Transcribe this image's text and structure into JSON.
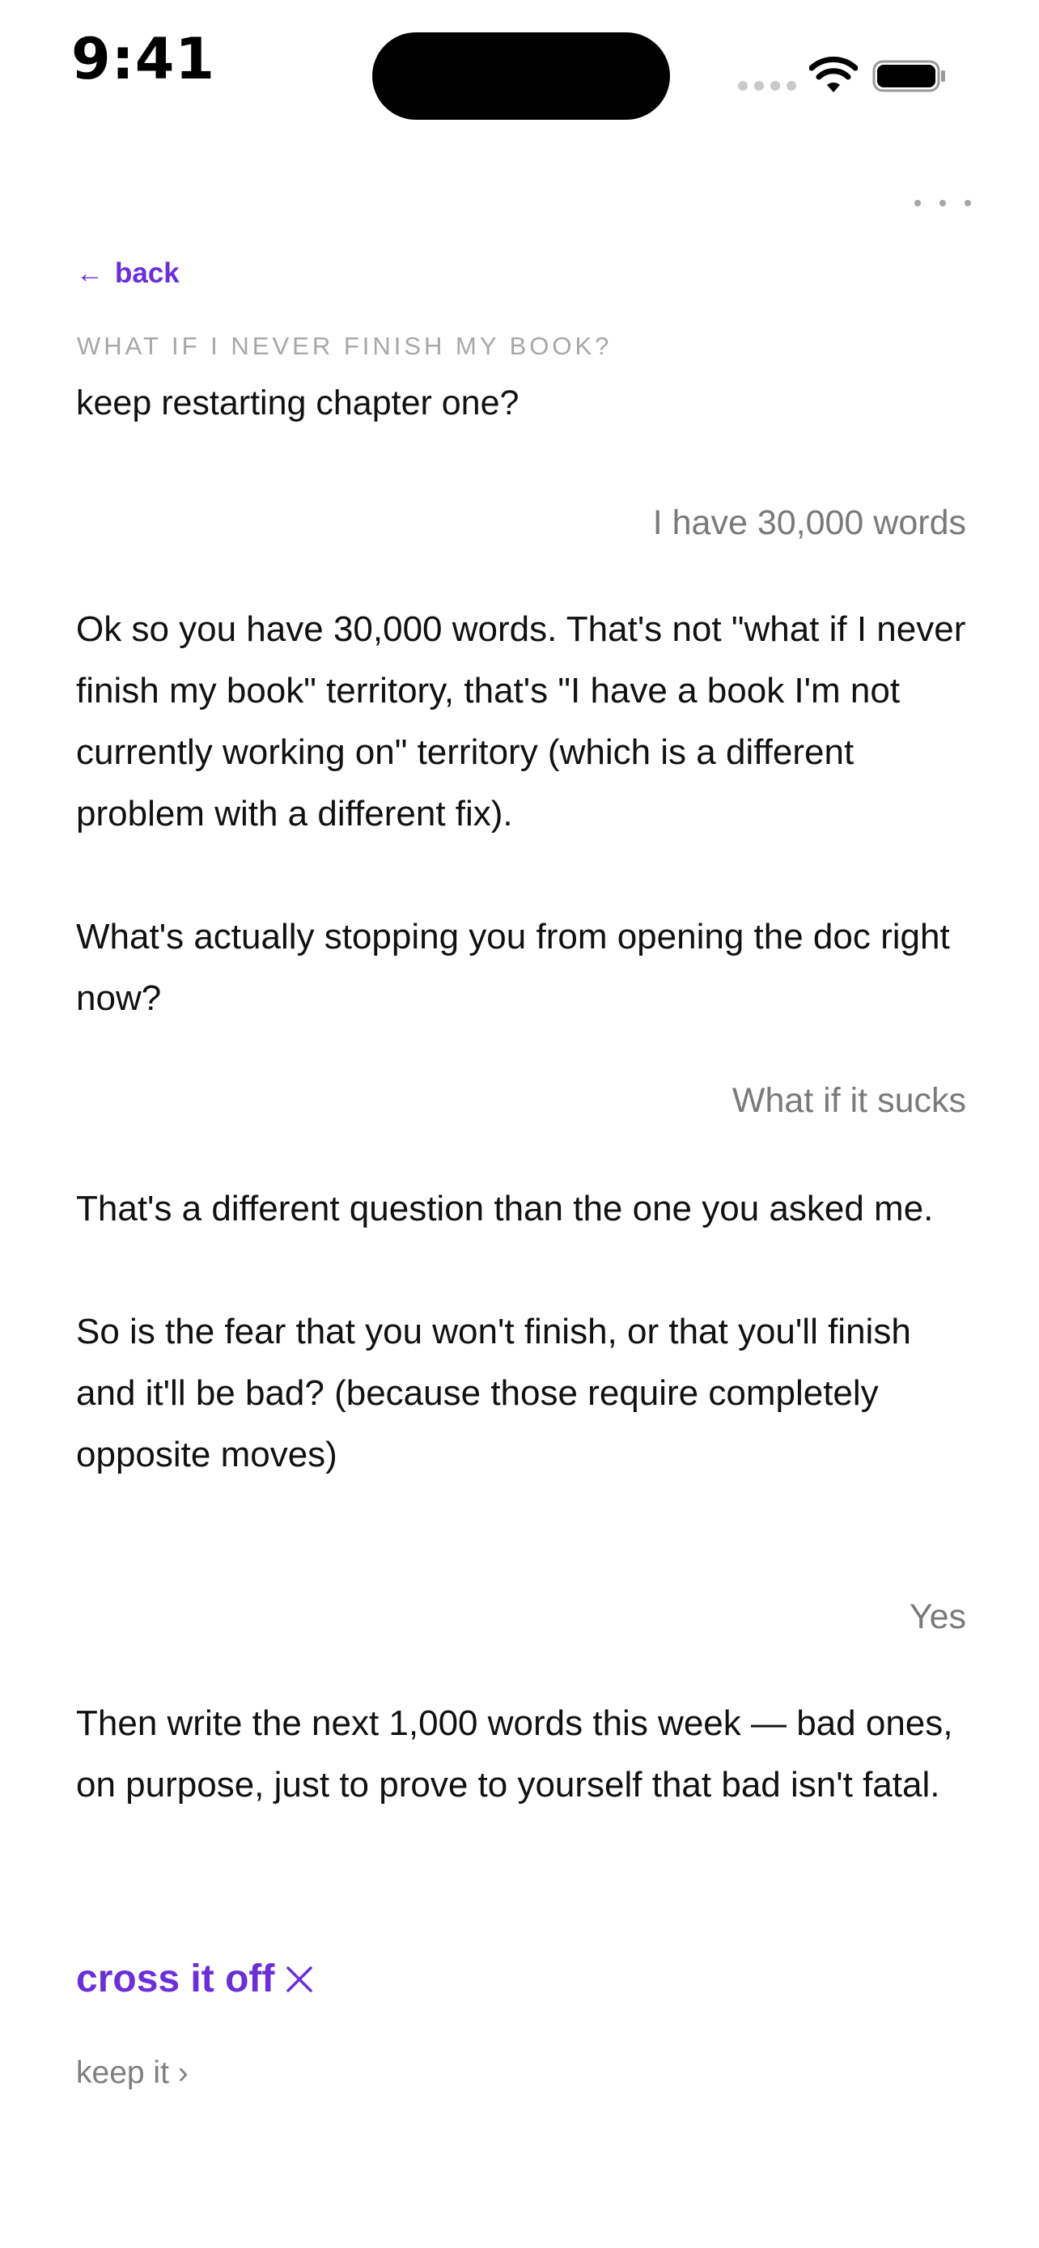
{
  "status_bar": {
    "time": "9:41"
  },
  "header": {
    "back_arrow": "←",
    "back_label": "back",
    "title": "WHAT IF I NEVER FINISH MY BOOK?",
    "more_icon": "more-horizontal-icon"
  },
  "conversation": {
    "clipped_line": "keep restarting chapter one?",
    "messages": [
      {
        "role": "user",
        "text": "I have 30,000 words"
      },
      {
        "role": "assistant",
        "paragraphs": [
          "Ok so you have 30,000 words. That's not \"what if I never finish my book\" territory, that's \"I have a book I'm not currently working on\" territory (which is a different problem with a different fix).",
          "What's actually stopping you from opening the doc right now?"
        ]
      },
      {
        "role": "user",
        "text": "What if it sucks"
      },
      {
        "role": "assistant",
        "paragraphs": [
          "That's a different question than the one you asked me.",
          "So is the fear that you won't finish, or that you'll finish and it'll be bad? (because those require completely opposite moves)"
        ]
      },
      {
        "role": "user",
        "text": "Yes"
      },
      {
        "role": "assistant",
        "paragraphs": [
          "Then write the next 1,000 words this week — bad ones, on purpose, just to prove to yourself that bad isn't fatal."
        ]
      }
    ]
  },
  "actions": {
    "cross_off_label": "cross it off",
    "keep_label": "keep it ›"
  },
  "colors": {
    "accent": "#6a2fd6",
    "muted_text": "#7a7a7a",
    "title_text": "#a7a7a7"
  }
}
